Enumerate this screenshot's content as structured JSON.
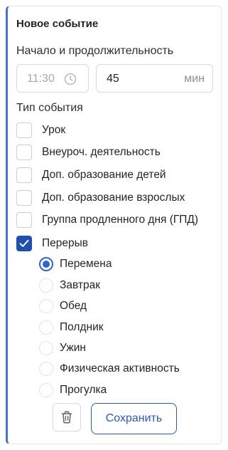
{
  "form": {
    "title": "Новое событие",
    "start_duration_label": "Начало и продолжительность",
    "start_time_placeholder": "11:30",
    "duration_value": "45",
    "duration_unit": "мин",
    "event_type_label": "Тип события"
  },
  "event_types": [
    {
      "label": "Урок",
      "checked": false
    },
    {
      "label": "Внеуроч. деятельность",
      "checked": false
    },
    {
      "label": "Доп. образование детей",
      "checked": false
    },
    {
      "label": "Доп. образование взрослых",
      "checked": false
    },
    {
      "label": "Группа продленного дня (ГПД)",
      "checked": false
    },
    {
      "label": "Перерыв",
      "checked": true
    }
  ],
  "break_types": [
    {
      "label": "Перемена",
      "selected": true
    },
    {
      "label": "Завтрак",
      "selected": false
    },
    {
      "label": "Обед",
      "selected": false
    },
    {
      "label": "Полдник",
      "selected": false
    },
    {
      "label": "Ужин",
      "selected": false
    },
    {
      "label": "Физическая активность",
      "selected": false
    },
    {
      "label": "Прогулка",
      "selected": false
    }
  ],
  "actions": {
    "delete_icon": "trash-icon",
    "save_label": "Сохранить"
  },
  "colors": {
    "accent": "#2b57c4",
    "accent_border": "#4a6fdc",
    "checkbox_checked": "#1f4fb5"
  }
}
